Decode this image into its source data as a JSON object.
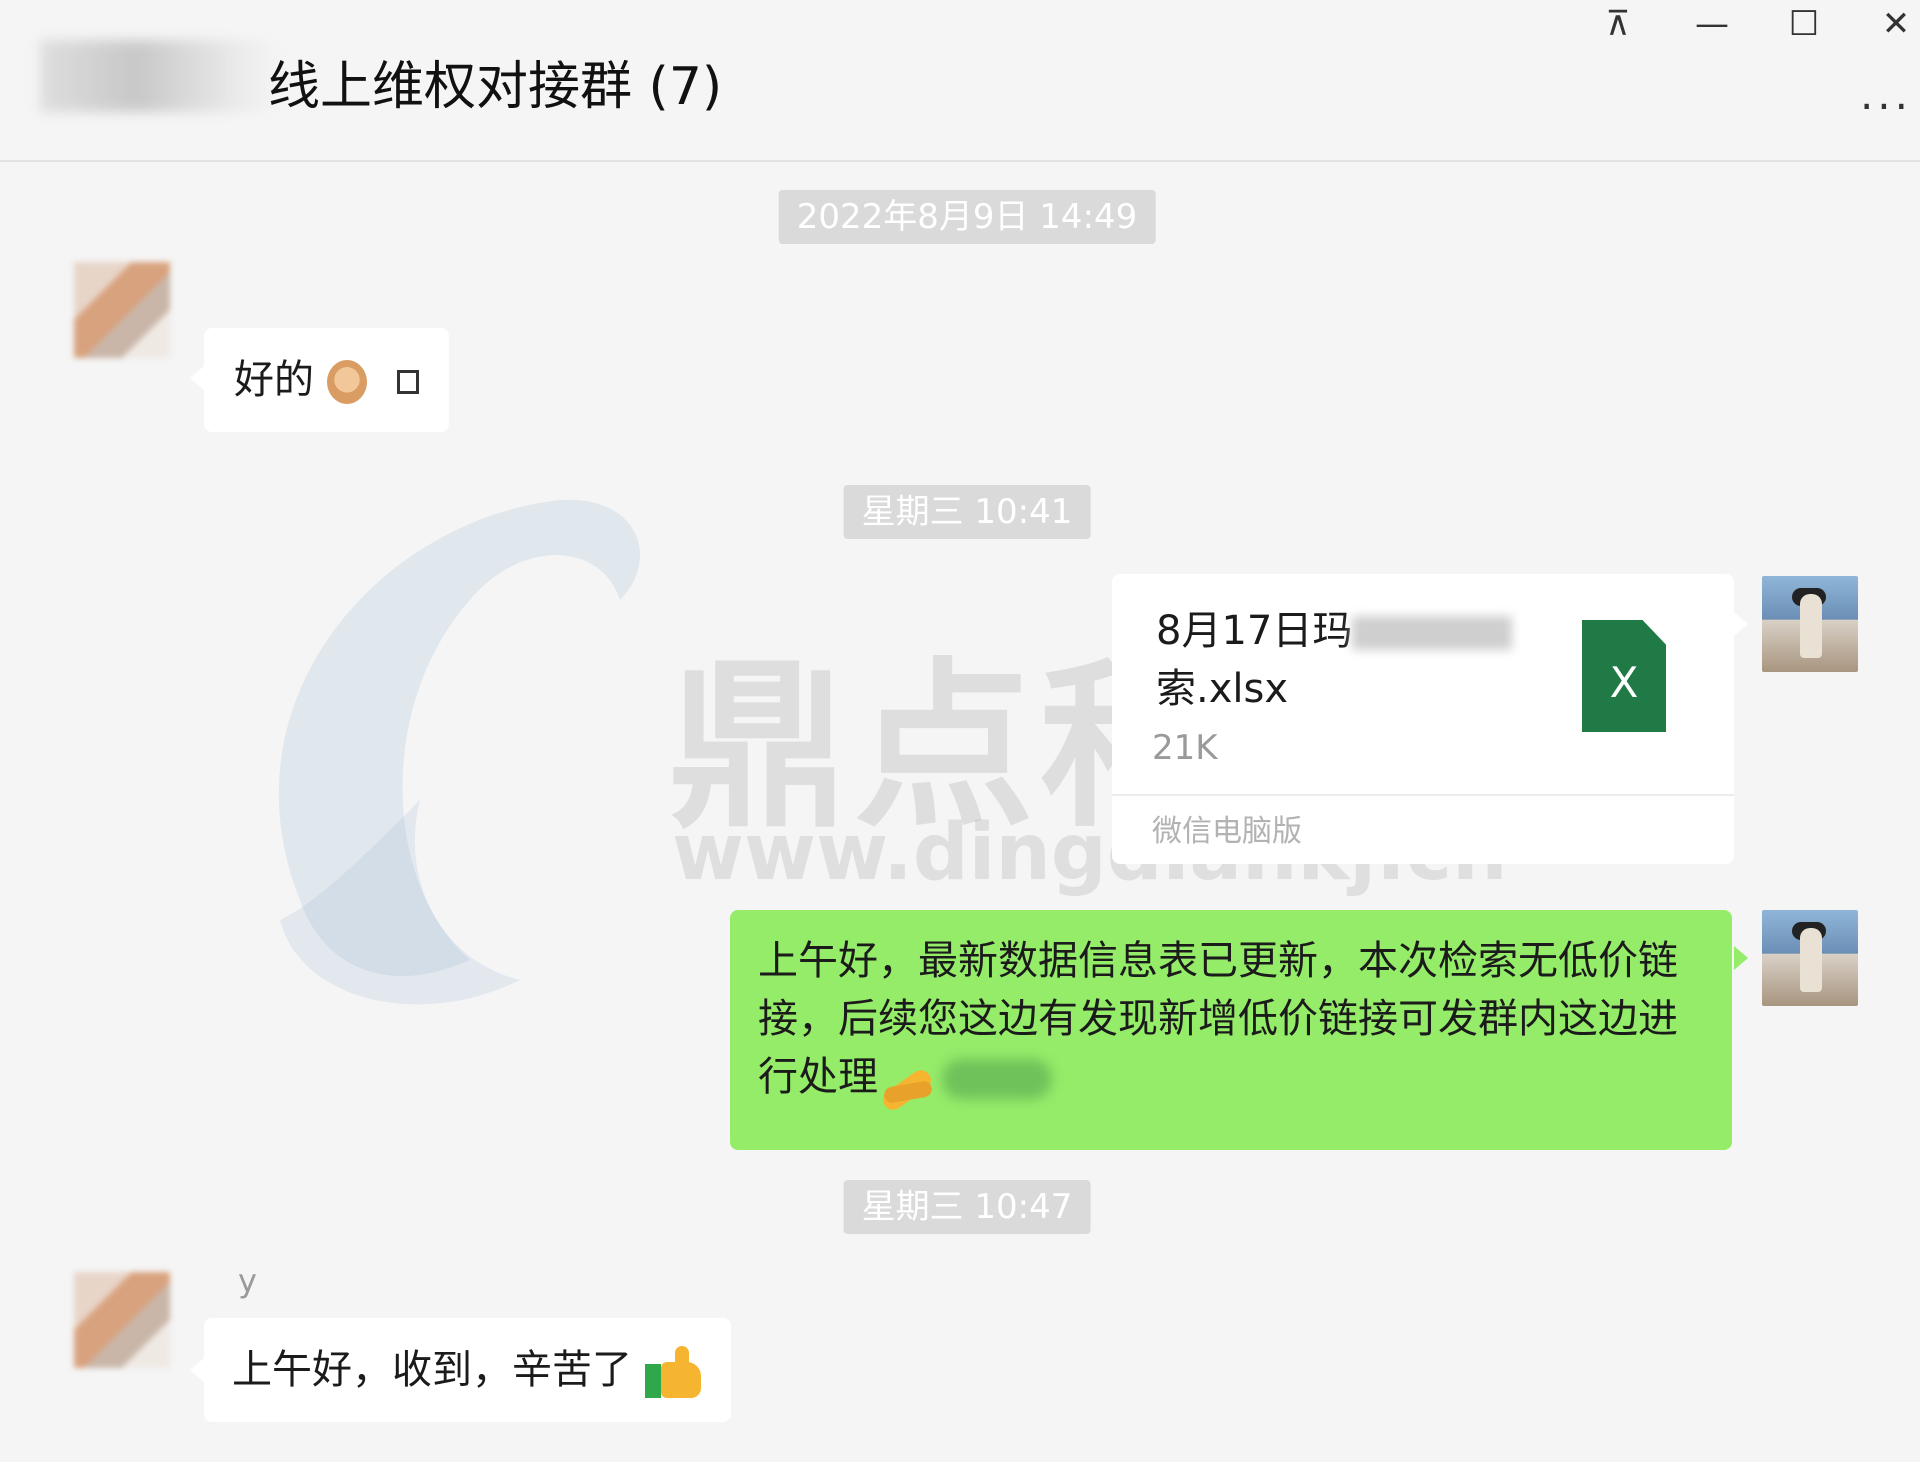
{
  "window": {
    "title": "线上维权对接群 (7)",
    "controls": {
      "pin": "⊼",
      "minimize": "—",
      "maximize": "☐",
      "close": "✕",
      "more": "..."
    }
  },
  "timestamps": [
    "2022年8月9日 14:49",
    "星期三 10:41",
    "星期三 10:47"
  ],
  "messages": [
    {
      "side": "left",
      "text": "好的"
    },
    {
      "side": "right",
      "type": "file",
      "file": {
        "name_part1": "8月17日玛",
        "name_part2": "索.xlsx",
        "size": "21K",
        "source": "微信电脑版",
        "icon": "excel-icon",
        "icon_letter": "X"
      }
    },
    {
      "side": "right",
      "text": "上午好，最新数据信息表已更新，本次检索无低价链接，后续您这边有发现新增低价链接可发群内这边进行处理"
    },
    {
      "side": "left",
      "sender": "y",
      "text": "上午好，收到，辛苦了"
    }
  ],
  "watermark": {
    "brand": "鼎点科技",
    "url": "www.dingdiankj.cn"
  },
  "colors": {
    "background": "#f5f5f5",
    "self_bubble": "#95ec69",
    "other_bubble": "#ffffff",
    "timestamp_bg": "#dadada",
    "excel": "#1f7a45"
  }
}
